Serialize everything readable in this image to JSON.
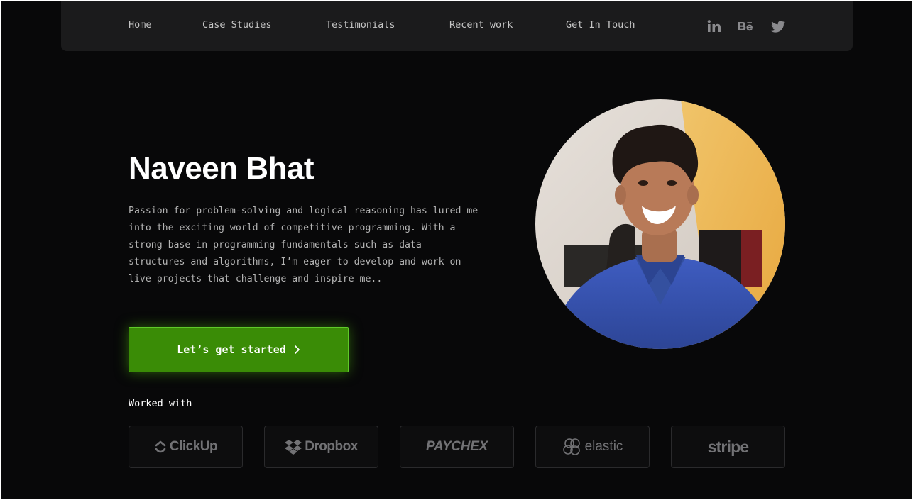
{
  "nav": {
    "links": [
      "Home",
      "Case Studies",
      "Testimonials",
      "Recent work",
      "Get In Touch"
    ],
    "social": [
      "linkedin-icon",
      "behance-icon",
      "twitter-icon"
    ]
  },
  "hero": {
    "name": "Naveen Bhat",
    "bio": "Passion for problem-solving and logical reasoning has lured me into the exciting world of competitive programming. With a strong base in programming fundamentals such as data structures and algorithms, I’m eager to develop and work on live projects that challenge and inspire me..",
    "cta_label": "Let’s get started"
  },
  "worked_with": {
    "label": "Worked with",
    "logos": [
      "ClickUp",
      "Dropbox",
      "PAYCHEX",
      "elastic",
      "stripe"
    ]
  },
  "colors": {
    "page_bg": "#080809",
    "nav_bg": "#1b1b1c",
    "accent_green": "#3a8c06",
    "accent_green_border": "#5fc92a",
    "muted_text": "#b4b4b4",
    "logo_gray": "#727275"
  }
}
